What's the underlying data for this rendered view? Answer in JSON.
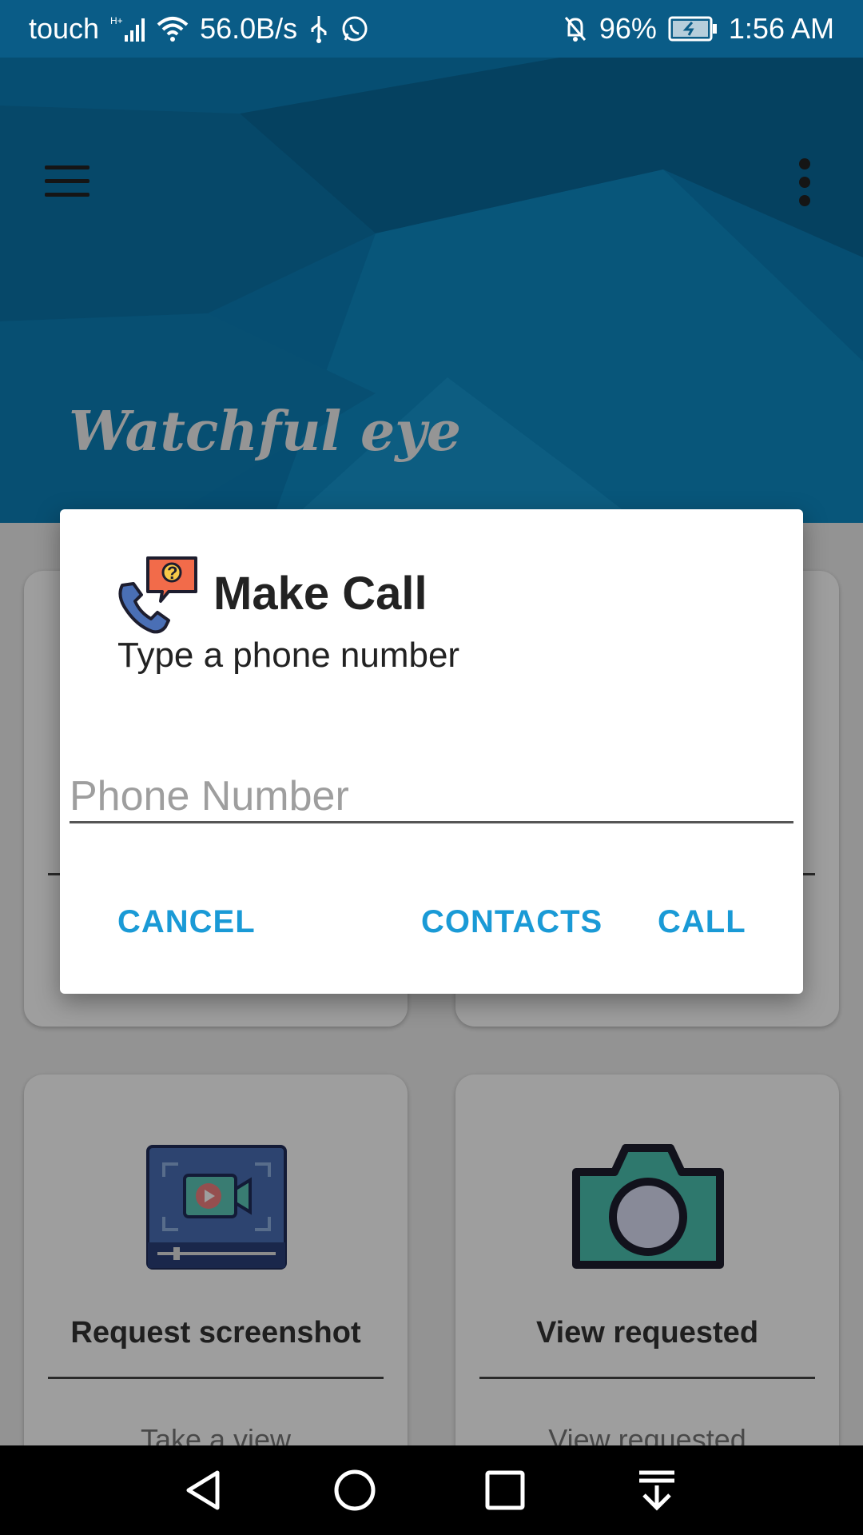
{
  "status_bar": {
    "carrier": "touch",
    "network_type": "H+",
    "speed": "56.0B/s",
    "battery": "96%",
    "time": "1:56 AM"
  },
  "app": {
    "title": "Watchful eye",
    "cards": [
      {
        "title": "Request screenshot",
        "subtitle": "Take a view",
        "icon": "video-screen-icon"
      },
      {
        "title": "View requested",
        "subtitle": "View requested",
        "icon": "camera-icon"
      }
    ]
  },
  "dialog": {
    "title": "Make Call",
    "message": "Type a phone number",
    "phone_input": {
      "value": "",
      "placeholder": "Phone Number"
    },
    "buttons": {
      "cancel": "CANCEL",
      "contacts": "CONTACTS",
      "call": "CALL"
    },
    "accent_color": "#1a9ad6"
  },
  "colors": {
    "header": "#0b7fb8",
    "status_bar": "#0a5c87",
    "nav_bar": "#000000"
  }
}
